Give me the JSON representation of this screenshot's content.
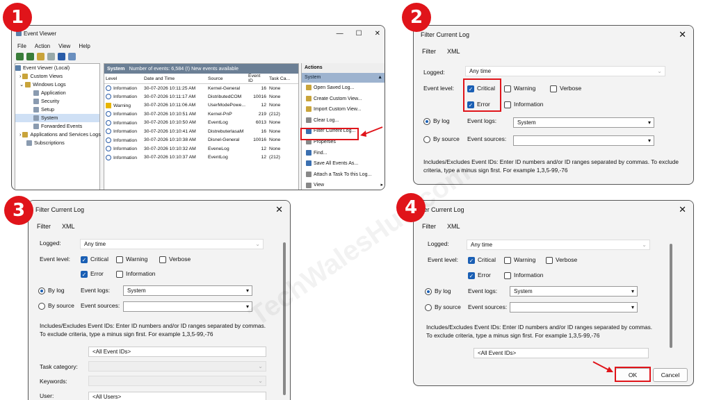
{
  "badges": [
    "1",
    "2",
    "3",
    "4"
  ],
  "watermark": "TechWalesHub.com",
  "event_viewer": {
    "title": "Event Viewer",
    "menu": [
      "File",
      "Action",
      "View",
      "Help"
    ],
    "tree": [
      "Event Viewer (Local)",
      "Custom Views",
      "Windows Logs",
      "Application",
      "Security",
      "Setup",
      "System",
      "Forwarded Events",
      "Applications and Services Logs",
      "Subscriptions"
    ],
    "header": "System",
    "header_info": "Number of events: 6,584 (!) New events available",
    "columns": [
      "Level",
      "Date and Time",
      "Source",
      "Event ID",
      "Task Ca..."
    ],
    "rows": [
      [
        "Information",
        "30-07-2026 10:11:25 AM",
        "Kernel-General",
        "16",
        "None"
      ],
      [
        "Information",
        "30-07-2026 10:11:17 AM",
        "DistributedCOM",
        "10016",
        "None"
      ],
      [
        "Warning",
        "30-07-2026 10:11:06 AM",
        "UserModePowe...",
        "12",
        "None"
      ],
      [
        "Information",
        "30-07-2026 10:10:51 AM",
        "Kernel-PnP",
        "219",
        "(212)"
      ],
      [
        "Information",
        "30-07-2026 10:10:50 AM",
        "EventLog",
        "6013",
        "None"
      ],
      [
        "Information",
        "30-07-2026 10:10:41 AM",
        "DistrebuterlasaM",
        "16",
        "None"
      ],
      [
        "Information",
        "30-07-2026 10:10:38 AM",
        "Disnel-General",
        "10016",
        "None"
      ],
      [
        "Information",
        "30-07-2026 10:10:32 AM",
        "EveneLog",
        "12",
        "None"
      ],
      [
        "Information",
        "30-07-2026 10:10:37 AM",
        "EventLog",
        "12",
        "(212)"
      ]
    ],
    "actions_title": "Actions",
    "actions_section": "System",
    "actions": [
      "Open Saved Log...",
      "Create Custom View...",
      "Import Custom View...",
      "Clear Log...",
      "Filter Current Log...",
      "Properties",
      "Find...",
      "Save All Events As...",
      "Attach a Task To this Log...",
      "View"
    ]
  },
  "dialog": {
    "title": "Filter Current Log",
    "title_cut": "lter Current Log",
    "tabs": [
      "Filter",
      "XML"
    ],
    "logged_label": "Logged:",
    "logged_value": "Any time",
    "event_level_label": "Event level:",
    "levels": [
      "Critical",
      "Warning",
      "Verbose",
      "Error",
      "Information"
    ],
    "by_log": "By log",
    "by_source": "By source",
    "event_logs_label": "Event logs:",
    "event_logs_value": "System",
    "event_sources_label": "Event sources:",
    "note": "Includes/Excludes Event IDs: Enter ID numbers and/or ID ranges separated by commas. To exclude criteria, type a minus sign first. For example 1,3,5-99,-76",
    "event_ids_value": "<All Event IDs>",
    "task_category_label": "Task category:",
    "keywords_label": "Keywords:",
    "user_label": "User:",
    "user_value": "<All Users>",
    "ok": "OK",
    "cancel": "Cancel"
  }
}
